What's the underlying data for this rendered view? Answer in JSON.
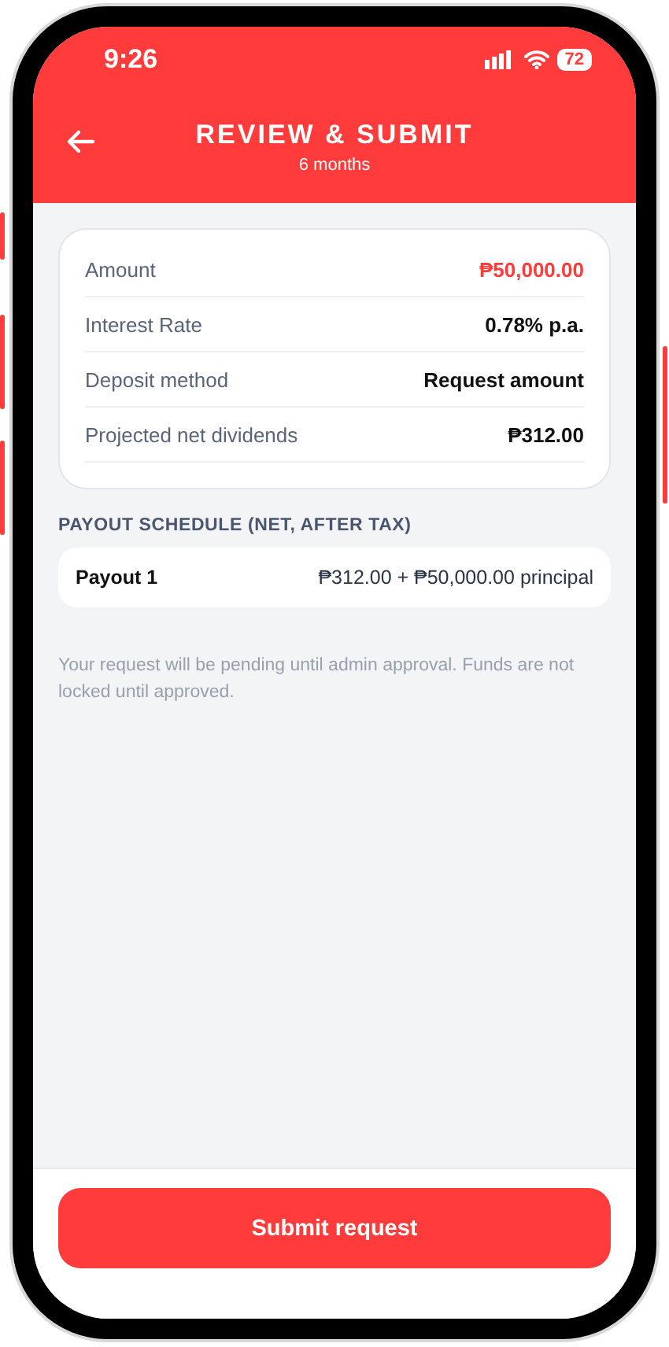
{
  "status_bar": {
    "time": "9:26",
    "battery": "72"
  },
  "header": {
    "title": "REVIEW & SUBMIT",
    "subtitle": "6 months"
  },
  "summary": [
    {
      "label": "Amount",
      "value": "₱50,000.00",
      "highlight": true
    },
    {
      "label": "Interest Rate",
      "value": "0.78% p.a.",
      "highlight": false
    },
    {
      "label": "Deposit method",
      "value": "Request amount",
      "highlight": false
    },
    {
      "label": "Projected net dividends",
      "value": "₱312.00",
      "highlight": false
    }
  ],
  "payout_schedule": {
    "heading": "PAYOUT SCHEDULE (NET, AFTER TAX)",
    "rows": [
      {
        "label": "Payout 1",
        "value": "₱312.00 + ₱50,000.00 principal"
      }
    ]
  },
  "note": "Your request will be pending until admin approval. Funds are not locked until approved.",
  "submit_button": "Submit request"
}
